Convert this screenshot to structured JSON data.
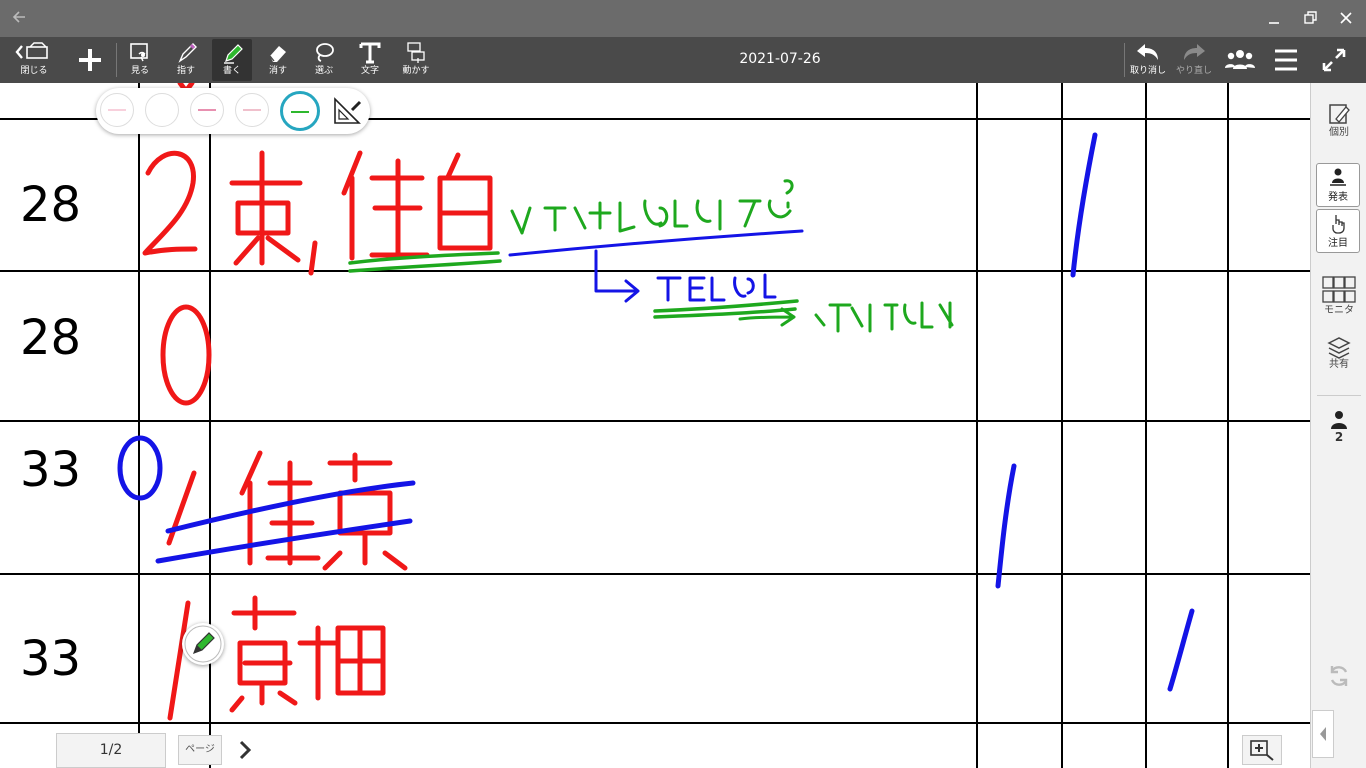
{
  "window": {
    "back_icon": "arrow-left-icon",
    "controls": [
      "minimize-icon",
      "restore-icon",
      "close-icon"
    ]
  },
  "toolbar": {
    "close_label": "閉じる",
    "add_icon": "plus-icon",
    "view_label": "見る",
    "point_label": "指す",
    "write_label": "書く",
    "erase_label": "消す",
    "select_label": "選ぶ",
    "text_label": "文字",
    "move_label": "動かす",
    "date": "2021-07-26",
    "undo_label": "取り消し",
    "redo_label": "やり直し",
    "group_icon": "group-icon",
    "menu_icon": "hamburger-menu-icon",
    "fullscreen_icon": "expand-icon"
  },
  "palette": {
    "swatches": [
      {
        "color": "#f8d0dc"
      },
      {
        "color": "#ffffff"
      },
      {
        "color": "#e890b0"
      },
      {
        "color": "#f0c0cc"
      },
      {
        "color": "#2eb82e",
        "selected": true
      }
    ],
    "ruler_icon": "ruler-icon",
    "selected_ring_color": "#26a6c0"
  },
  "board": {
    "rows": [
      {
        "number": "28"
      },
      {
        "number": "28"
      },
      {
        "number": "33"
      },
      {
        "number": "33"
      }
    ],
    "ink_colors": {
      "red": "#f01818",
      "green": "#1ea81e",
      "blue": "#1414e6"
    }
  },
  "sidebar": {
    "individual_label": "個別",
    "present_label": "発表",
    "attention_label": "注目",
    "monitor_label": "モニタ",
    "share_label": "共有",
    "user_count": "2",
    "refresh_icon": "refresh-icon"
  },
  "footer": {
    "page_indicator": "1/2",
    "page_button": "ページ",
    "next_icon": "chevron-right-icon",
    "zoom_icon": "zoom-in-icon",
    "collapse_icon": "chevron-left-icon"
  }
}
